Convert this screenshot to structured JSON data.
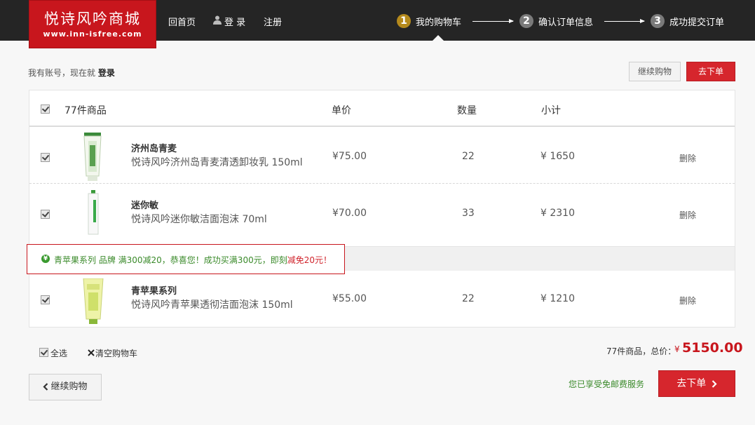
{
  "header": {
    "logo_title": "悦诗风吟商城",
    "logo_url": "www.inn-isfree.com",
    "nav": {
      "home": "回首页",
      "login": "登 录",
      "register": "注册"
    },
    "steps": [
      {
        "num": "1",
        "label": "我的购物车"
      },
      {
        "num": "2",
        "label": "确认订单信息"
      },
      {
        "num": "3",
        "label": "成功提交订单"
      }
    ]
  },
  "account": {
    "prompt": "我有账号，现在就",
    "login": "登录"
  },
  "top_buttons": {
    "continue": "继续购物",
    "checkout": "去下单"
  },
  "cart": {
    "head": {
      "count": "77件商品",
      "unit_price": "单价",
      "quantity": "数量",
      "subtotal": "小计"
    },
    "items": [
      {
        "name": "济州岛青麦",
        "desc": "悦诗风吟济州岛青麦清透卸妆乳 150ml",
        "price": "¥75.00",
        "qty": "22",
        "subtotal": "¥ 1650",
        "delete": "删除"
      },
      {
        "name": "迷你敏",
        "desc": "悦诗风吟迷你敏洁面泡沫 70ml",
        "price": "¥70.00",
        "qty": "33",
        "subtotal": "¥ 2310",
        "delete": "删除"
      },
      {
        "name": "青苹果系列",
        "desc": "悦诗风吟青苹果透彻洁面泡沫 150ml",
        "price": "¥55.00",
        "qty": "22",
        "subtotal": "¥ 1210",
        "delete": "删除"
      }
    ],
    "promo": {
      "icon": "¥",
      "text": "青苹果系列 品牌 满300减20，恭喜您！成功买满300元，即刻",
      "highlight": "减免20元！"
    }
  },
  "footer": {
    "select_all": "全选",
    "clear_cart": "清空购物车",
    "total_label": "77件商品，总价：",
    "total_symbol": "¥",
    "total_value": "5150.00",
    "free_shipping": "您已享受免邮费服务",
    "continue": "继续购物",
    "checkout": "去下单"
  },
  "colors": {
    "brand_red": "#c8161d",
    "header_bg": "#252525",
    "step_active": "#b58a1c",
    "promo_green": "#3a8a2a"
  },
  "icons": [
    "user-icon",
    "checkmark-icon",
    "tube-product-icon",
    "yuan-coin-icon",
    "close-x-icon",
    "chevron-left-icon",
    "chevron-right-icon"
  ]
}
